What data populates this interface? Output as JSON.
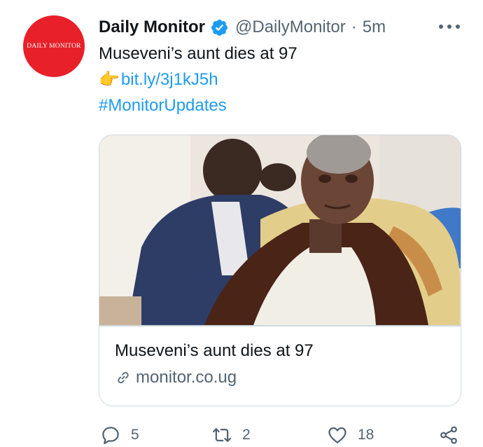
{
  "tweet": {
    "author": {
      "name": "Daily Monitor",
      "handle": "@DailyMonitor",
      "separator": "·",
      "time": "5m",
      "avatar_text": "DAILY MONITOR",
      "verified_icon": "verified-badge-icon"
    },
    "text": {
      "line1": "Museveni’s aunt dies at 97",
      "finger_emoji": "👉",
      "link": "bit.ly/3j1kJ5h",
      "hashtag": "#MonitorUpdates"
    },
    "card": {
      "title": "Museveni’s aunt dies at 97",
      "domain": "monitor.co.ug"
    },
    "actions": {
      "replies": "5",
      "retweets": "2",
      "likes": "18"
    }
  },
  "colors": {
    "accent": "#1d9bf0",
    "brand_red": "#e8202a",
    "secondary_text": "#536471",
    "border": "#cfd9de"
  }
}
